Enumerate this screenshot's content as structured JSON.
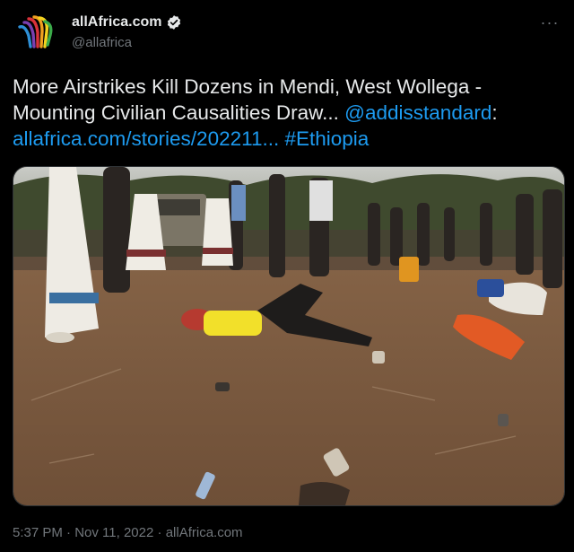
{
  "author": {
    "display_name": "allAfrica.com",
    "handle": "@allafrica",
    "verified": true
  },
  "tweet": {
    "text_main": "More Airstrikes Kill Dozens in Mendi, West Wollega - Mounting Civilian Causalities Draw... ",
    "mention": "@addisstandard",
    "colon": ":",
    "link_text": "allafrica.com/stories/202211...",
    "hashtag": "#Ethiopia"
  },
  "meta": {
    "time": "5:37 PM",
    "sep1": " · ",
    "date": "Nov 11, 2022",
    "sep2": " · ",
    "source": "allAfrica.com"
  },
  "icons": {
    "verified": "verified-badge-icon",
    "more": "more-options-icon",
    "avatar": "allafrica-logo"
  },
  "colors": {
    "background": "#000000",
    "text": "#e7e9ea",
    "secondary": "#71767b",
    "link": "#1d9bf0"
  }
}
